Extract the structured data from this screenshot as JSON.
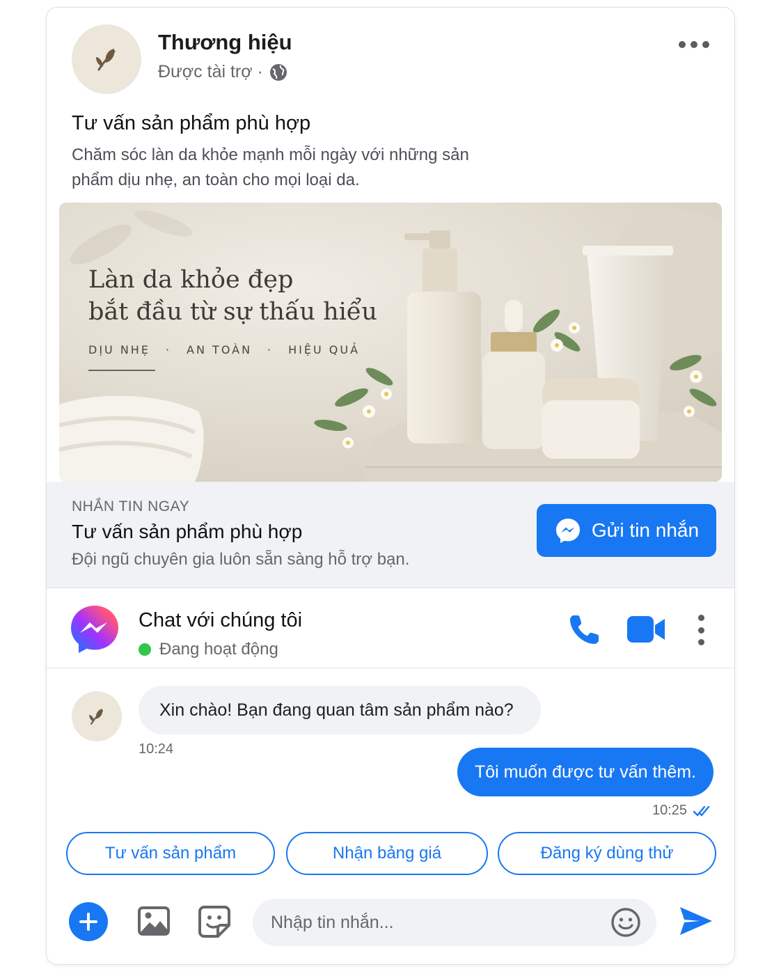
{
  "post": {
    "brand_name": "Thương hiệu",
    "sponsored_label": "Được tài trợ ·",
    "title": "Tư vấn sản phẩm phù hợp",
    "description": "Chăm sóc làn da khỏe mạnh mỗi ngày với những sản phẩm dịu nhẹ, an toàn cho mọi loại da."
  },
  "hero": {
    "headline": "Làn da khỏe đẹp\nbắt đầu từ sự thấu hiểu",
    "tags": [
      "DỊU NHẸ",
      "·",
      "AN TOÀN",
      "·",
      "HIỆU QUẢ"
    ]
  },
  "cta": {
    "kicker": "NHẮN TIN NGAY",
    "title": "Tư vấn sản phẩm phù hợp",
    "subtitle": "Đội ngũ chuyên gia luôn sẵn sàng hỗ trợ bạn.",
    "button_label": "Gửi tin nhắn"
  },
  "chat": {
    "title": "Chat với chúng tôi",
    "status": "Đang hoạt động",
    "messages": [
      {
        "from": "brand",
        "text": "Xin chào! Bạn đang quan tâm sản phẩm nào?",
        "time": "10:24"
      },
      {
        "from": "user",
        "text": "Tôi muốn được tư vấn thêm.",
        "time": "10:25"
      }
    ],
    "quick_replies": [
      "Tư vấn sản phẩm",
      "Nhận bảng giá",
      "Đăng ký dùng thử"
    ],
    "input_placeholder": "Nhập tin nhắn..."
  },
  "colors": {
    "accent": "#1877f2",
    "online": "#31c64c",
    "brand_avatar_bg": "#ece6db"
  },
  "icons": [
    "leaf-icon",
    "globe-icon",
    "more-icon",
    "messenger-icon",
    "phone-icon",
    "video-icon",
    "kebab-icon",
    "double-check-icon",
    "plus-icon",
    "image-icon",
    "sticker-icon",
    "emoji-icon",
    "send-icon"
  ]
}
